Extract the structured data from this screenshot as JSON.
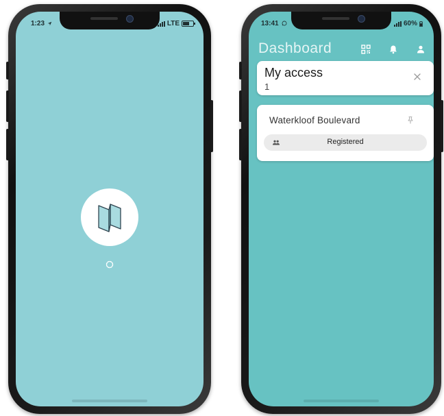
{
  "left_phone": {
    "status": {
      "time": "1:23",
      "network": "LTE"
    }
  },
  "right_phone": {
    "status": {
      "time": "13:41",
      "battery": "60%"
    },
    "header": {
      "title": "Dashboard",
      "icons": [
        "qr-code-icon",
        "bell-icon",
        "user-icon"
      ]
    },
    "access_card": {
      "title": "My access",
      "count": "1"
    },
    "site_card": {
      "name": "Waterkloof Boulevard",
      "status": "Registered"
    }
  },
  "colors": {
    "splash_bg": "#8fd0d6",
    "dashboard_bg": "#67c2c2",
    "card_bg": "#ffffff",
    "pill_bg": "#ebebeb"
  }
}
